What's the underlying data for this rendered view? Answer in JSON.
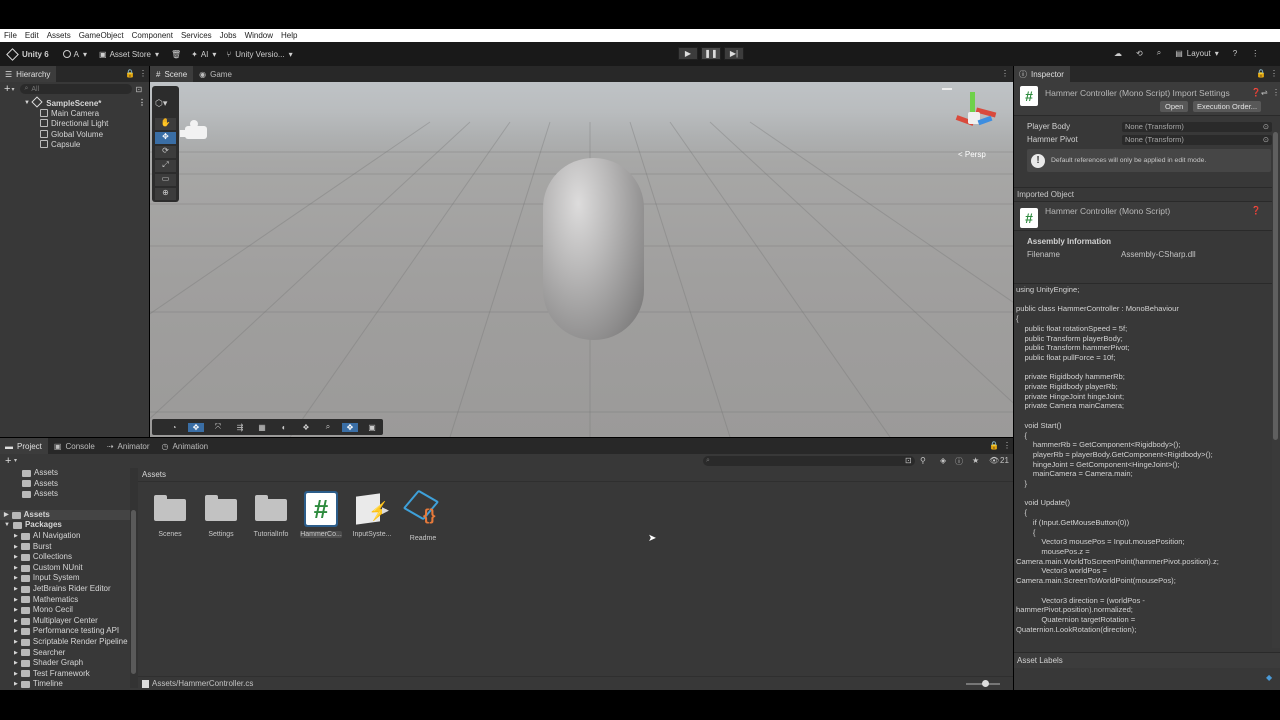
{
  "menu": [
    "File",
    "Edit",
    "Assets",
    "GameObject",
    "Component",
    "Services",
    "Jobs",
    "Window",
    "Help"
  ],
  "toolbar": {
    "unity_label": "Unity 6",
    "account_label": "A",
    "asset_store_label": "Asset Store",
    "ai_label": "AI",
    "version_label": "Unity Versio...",
    "layout_label": "Layout"
  },
  "hierarchy": {
    "tab_label": "Hierarchy",
    "search_placeholder": "All",
    "scene_name": "SampleScene*",
    "items": [
      "Main Camera",
      "Directional Light",
      "Global Volume",
      "Capsule"
    ]
  },
  "scene_view": {
    "tabs": [
      "Scene",
      "Game"
    ],
    "persp_label": "< Persp"
  },
  "inspector": {
    "tab_label": "Inspector",
    "title": "Hammer Controller (Mono Script) Import Settings",
    "open_button": "Open",
    "execution_order_button": "Execution Order...",
    "fields": [
      {
        "label": "Player Body",
        "value": "None (Transform)"
      },
      {
        "label": "Hammer Pivot",
        "value": "None (Transform)"
      }
    ],
    "info_message": "Default references will only be applied in edit mode.",
    "imported_object_header": "Imported Object",
    "imported_title": "Hammer Controller (Mono Script)",
    "assembly_header": "Assembly Information",
    "filename_label": "Filename",
    "filename_value": "Assembly-CSharp.dll",
    "code": "using UnityEngine;\n\npublic class HammerController : MonoBehaviour\n{\n    public float rotationSpeed = 5f;\n    public Transform playerBody;\n    public Transform hammerPivot;\n    public float pullForce = 10f;\n\n    private Rigidbody hammerRb;\n    private Rigidbody playerRb;\n    private HingeJoint hingeJoint;\n    private Camera mainCamera;\n\n    void Start()\n    {\n        hammerRb = GetComponent<Rigidbody>();\n        playerRb = playerBody.GetComponent<Rigidbody>();\n        hingeJoint = GetComponent<HingeJoint>();\n        mainCamera = Camera.main;\n    }\n\n    void Update()\n    {\n        if (Input.GetMouseButton(0))\n        {\n            Vector3 mousePos = Input.mousePosition;\n            mousePos.z =\nCamera.main.WorldToScreenPoint(hammerPivot.position).z;\n            Vector3 worldPos =\nCamera.main.ScreenToWorldPoint(mousePos);\n\n            Vector3 direction = (worldPos -\nhammerPivot.position).normalized;\n            Quaternion targetRotation =\nQuaternion.LookRotation(direction);",
    "asset_labels": "Asset Labels"
  },
  "project": {
    "tabs": [
      "Project",
      "Console",
      "Animator",
      "Animation"
    ],
    "breadcrumb": "Assets",
    "hidden_count": "21",
    "favorites": [
      "Assets",
      "Assets",
      "Assets"
    ],
    "assets_root": "Assets",
    "packages_root": "Packages",
    "packages": [
      "AI Navigation",
      "Burst",
      "Collections",
      "Custom NUnit",
      "Input System",
      "JetBrains Rider Editor",
      "Mathematics",
      "Mono Cecil",
      "Multiplayer Center",
      "Performance testing API",
      "Scriptable Render Pipeline",
      "Searcher",
      "Shader Graph",
      "Test Framework",
      "Timeline"
    ],
    "assets": [
      {
        "name": "Scenes",
        "icon": "folder-icon"
      },
      {
        "name": "Settings",
        "icon": "folder-icon"
      },
      {
        "name": "TutorialInfo",
        "icon": "folder-icon"
      },
      {
        "name": "HammerCo...",
        "icon": "csharp-script-icon"
      },
      {
        "name": "InputSyste...",
        "icon": "input-actions-icon"
      },
      {
        "name": "Readme",
        "icon": "readme-icon"
      }
    ],
    "status_path": "Assets/HammerController.cs"
  }
}
